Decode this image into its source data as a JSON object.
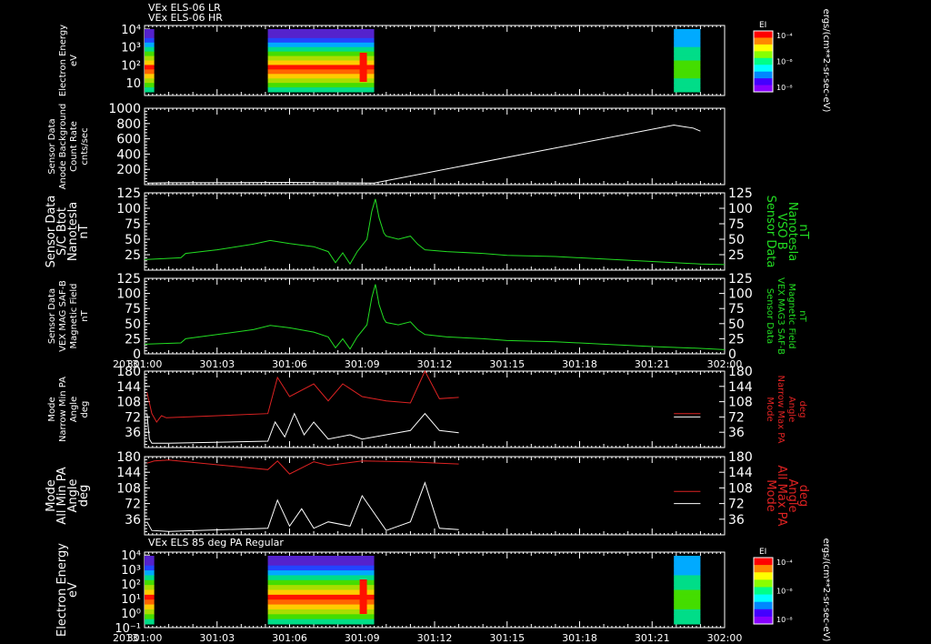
{
  "colors": {
    "bg": "#000000",
    "fg": "#ffffff",
    "green": "#22dd22",
    "red": "#dd2222"
  },
  "time_axis": {
    "year": "2013",
    "tick_labels": [
      "301:00",
      "301:03",
      "301:06",
      "301:09",
      "301:12",
      "301:15",
      "301:18",
      "301:21",
      "302:00"
    ]
  },
  "chart_data": [
    {
      "type": "heatmap",
      "name": "els-lr",
      "titles": [
        "VEx ELS-06 LR",
        "VEx ELS-06 HR"
      ],
      "ylabel": [
        "Electron Energy",
        "eV"
      ],
      "yscale": "log",
      "y_tick_labels": [
        {
          "v": 10,
          "label": "10"
        },
        {
          "v": 100,
          "label": "10²"
        },
        {
          "v": 1000,
          "label": "10³"
        },
        {
          "v": 10000,
          "label": "10⁴"
        }
      ],
      "colorbar": {
        "title": "EI",
        "units": "ergs/(cm**2-sr-sec-eV)",
        "tick_labels": [
          "10⁻⁴",
          "10⁻⁶",
          "10⁻⁸"
        ]
      },
      "data_intervals": [
        {
          "start": 0,
          "end": 0.4
        },
        {
          "start": 5.1,
          "end": 9.5
        },
        {
          "start": 21.9,
          "end": 23.0
        }
      ]
    },
    {
      "type": "line",
      "name": "background",
      "ylabel": [
        "Sensor Data",
        "Anode Background",
        "Count Rate",
        "cnts/sec"
      ],
      "ylim": [
        0,
        1000
      ],
      "y_tick_labels": [
        "200",
        "400",
        "600",
        "800",
        "1000"
      ],
      "series": [
        {
          "color": "white",
          "points": [
            [
              0.1,
              20
            ],
            [
              1.0,
              25
            ],
            [
              5.0,
              28
            ],
            [
              6.0,
              30
            ],
            [
              7.0,
              27
            ],
            [
              8.0,
              24
            ],
            [
              9.5,
              22
            ],
            [
              21.9,
              780
            ],
            [
              22.3,
              760
            ],
            [
              22.7,
              740
            ],
            [
              23.0,
              700
            ]
          ]
        }
      ]
    },
    {
      "type": "line",
      "name": "btot",
      "ylabel": [
        "Sensor Data",
        "S/C Btot",
        "Nanotesla",
        "nT"
      ],
      "ylabel_right": [
        "Sensor Data",
        "VSO B",
        "Nanotesla",
        "nT"
      ],
      "ylim": [
        0,
        125
      ],
      "y_tick_labels": [
        "25",
        "50",
        "75",
        "100",
        "125"
      ],
      "series": [
        {
          "color": "green",
          "points": [
            [
              0,
              17
            ],
            [
              1.5,
              20
            ],
            [
              1.7,
              27
            ],
            [
              3,
              33
            ],
            [
              4.5,
              42
            ],
            [
              5.2,
              48
            ],
            [
              6.0,
              43
            ],
            [
              7.0,
              38
            ],
            [
              7.6,
              30
            ],
            [
              7.9,
              12
            ],
            [
              8.2,
              28
            ],
            [
              8.5,
              10
            ],
            [
              8.8,
              30
            ],
            [
              9.2,
              50
            ],
            [
              9.4,
              95
            ],
            [
              9.55,
              115
            ],
            [
              9.7,
              85
            ],
            [
              9.9,
              60
            ],
            [
              10.0,
              55
            ],
            [
              10.5,
              50
            ],
            [
              11.0,
              55
            ],
            [
              11.3,
              42
            ],
            [
              11.6,
              33
            ],
            [
              12.5,
              30
            ],
            [
              14,
              27
            ],
            [
              15,
              24
            ],
            [
              17,
              22
            ],
            [
              19,
              18
            ],
            [
              21,
              14
            ],
            [
              23,
              10
            ],
            [
              24,
              9
            ]
          ]
        }
      ]
    },
    {
      "type": "line",
      "name": "mag",
      "ylabel": [
        "Sensor Data",
        "VEX MAG SAF-B",
        "Magnetic Field",
        "nT"
      ],
      "ylabel_right": [
        "Sensor Data",
        "VEX MAG3 SAF-B",
        "Magnetic Field",
        "nT"
      ],
      "ylim": [
        0,
        125
      ],
      "y_tick_labels": [
        "0",
        "25",
        "50",
        "75",
        "100",
        "125"
      ],
      "series": [
        {
          "color": "green",
          "points": [
            [
              0,
              16
            ],
            [
              1.5,
              18
            ],
            [
              1.7,
              25
            ],
            [
              3,
              32
            ],
            [
              4.5,
              40
            ],
            [
              5.2,
              47
            ],
            [
              6.0,
              43
            ],
            [
              7.0,
              36
            ],
            [
              7.6,
              28
            ],
            [
              7.9,
              10
            ],
            [
              8.2,
              25
            ],
            [
              8.5,
              8
            ],
            [
              8.8,
              28
            ],
            [
              9.2,
              48
            ],
            [
              9.4,
              93
            ],
            [
              9.55,
              115
            ],
            [
              9.7,
              82
            ],
            [
              9.9,
              58
            ],
            [
              10.0,
              52
            ],
            [
              10.5,
              48
            ],
            [
              11.0,
              53
            ],
            [
              11.3,
              40
            ],
            [
              11.6,
              32
            ],
            [
              12.5,
              28
            ],
            [
              14,
              25
            ],
            [
              15,
              22
            ],
            [
              17,
              20
            ],
            [
              19,
              16
            ],
            [
              21,
              12
            ],
            [
              23,
              9
            ],
            [
              24,
              7
            ]
          ]
        }
      ]
    },
    {
      "type": "line",
      "name": "narrow-pa",
      "ylabel": [
        "Mode",
        "Narrow Min PA",
        "Angle",
        "deg"
      ],
      "ylabel_right": [
        "Mode",
        "Narrow Max PA",
        "Angle",
        "deg"
      ],
      "ylim": [
        0,
        180
      ],
      "y_tick_labels": [
        "36",
        "72",
        "108",
        "144",
        "180"
      ],
      "series": [
        {
          "color": "red",
          "points": [
            [
              0.1,
              130
            ],
            [
              0.3,
              80
            ],
            [
              0.5,
              60
            ],
            [
              0.7,
              75
            ],
            [
              0.9,
              70
            ],
            [
              5.1,
              80
            ],
            [
              5.5,
              165
            ],
            [
              6,
              120
            ],
            [
              7,
              150
            ],
            [
              7.6,
              110
            ],
            [
              8.2,
              150
            ],
            [
              9.0,
              120
            ],
            [
              10,
              110
            ],
            [
              11,
              105
            ],
            [
              11.6,
              180
            ],
            [
              12.2,
              115
            ],
            [
              13,
              118
            ]
          ]
        },
        {
          "color": "white",
          "points": [
            [
              0.1,
              80
            ],
            [
              0.2,
              20
            ],
            [
              0.3,
              10
            ],
            [
              1.0,
              10
            ],
            [
              5.1,
              15
            ],
            [
              5.4,
              60
            ],
            [
              5.8,
              25
            ],
            [
              6.2,
              80
            ],
            [
              6.6,
              30
            ],
            [
              7.0,
              60
            ],
            [
              7.6,
              20
            ],
            [
              8.5,
              30
            ],
            [
              9.0,
              20
            ],
            [
              10.0,
              30
            ],
            [
              11.0,
              40
            ],
            [
              11.6,
              80
            ],
            [
              12.2,
              40
            ],
            [
              13,
              35
            ]
          ]
        },
        {
          "color": "red",
          "points": [
            [
              21.9,
              80
            ],
            [
              23.0,
              80
            ]
          ]
        },
        {
          "color": "white",
          "points": [
            [
              21.9,
              72
            ],
            [
              23.0,
              72
            ]
          ]
        }
      ]
    },
    {
      "type": "line",
      "name": "all-pa",
      "ylabel": [
        "Mode",
        "All Min PA",
        "Angle",
        "deg"
      ],
      "ylabel_right": [
        "Mode",
        "All Max PA",
        "Angle",
        "deg"
      ],
      "ylim": [
        0,
        180
      ],
      "y_tick_labels": [
        "36",
        "72",
        "108",
        "144",
        "180"
      ],
      "series": [
        {
          "color": "red",
          "points": [
            [
              0.1,
              165
            ],
            [
              0.4,
              170
            ],
            [
              1.0,
              172
            ],
            [
              5.1,
              150
            ],
            [
              5.5,
              170
            ],
            [
              6.0,
              140
            ],
            [
              7.0,
              168
            ],
            [
              7.6,
              160
            ],
            [
              9.0,
              170
            ],
            [
              11.0,
              168
            ],
            [
              12.2,
              165
            ],
            [
              13,
              163
            ]
          ]
        },
        {
          "color": "white",
          "points": [
            [
              0.1,
              30
            ],
            [
              0.3,
              10
            ],
            [
              1.0,
              8
            ],
            [
              5.1,
              15
            ],
            [
              5.5,
              80
            ],
            [
              6.0,
              20
            ],
            [
              6.5,
              60
            ],
            [
              7.0,
              15
            ],
            [
              7.6,
              30
            ],
            [
              8.5,
              20
            ],
            [
              9.0,
              90
            ],
            [
              10.0,
              10
            ],
            [
              11.0,
              30
            ],
            [
              11.6,
              120
            ],
            [
              12.2,
              15
            ],
            [
              13,
              12
            ]
          ]
        },
        {
          "color": "red",
          "points": [
            [
              21.9,
              100
            ],
            [
              23.0,
              100
            ]
          ]
        },
        {
          "color": "white",
          "points": [
            [
              21.9,
              72
            ],
            [
              23.0,
              72
            ]
          ]
        }
      ]
    },
    {
      "type": "heatmap",
      "name": "els-85",
      "titles": [
        "VEx ELS 85 deg PA Regular"
      ],
      "ylabel": [
        "Electron Energy",
        "eV"
      ],
      "yscale": "log",
      "y_tick_labels": [
        {
          "v": 10,
          "label": "10¹"
        },
        {
          "v": 100,
          "label": "10²"
        },
        {
          "v": 1000,
          "label": "10³"
        },
        {
          "v": 10000,
          "label": "10⁴"
        },
        {
          "v": 1,
          "label": "10⁰"
        },
        {
          "v": 0.1,
          "label": "10⁻¹"
        }
      ],
      "colorbar": {
        "title": "EI",
        "units": "ergs/(cm**2-sr-sec-eV)",
        "tick_labels": [
          "10⁻⁴",
          "10⁻⁶",
          "10⁻⁸"
        ]
      },
      "data_intervals": [
        {
          "start": 0,
          "end": 0.4
        },
        {
          "start": 5.1,
          "end": 9.5
        },
        {
          "start": 21.9,
          "end": 23.0
        }
      ]
    }
  ]
}
